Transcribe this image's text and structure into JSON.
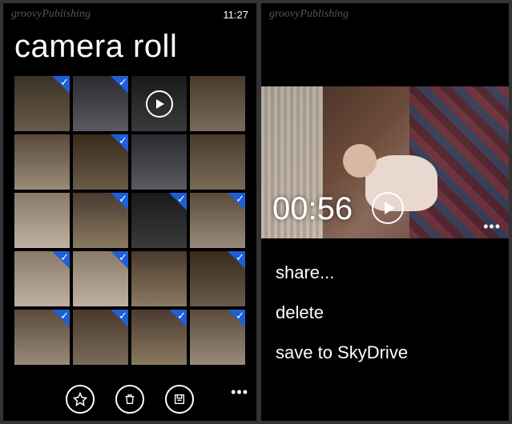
{
  "left": {
    "watermark": "groovyPublishing",
    "clock": "11:27",
    "title": "camera roll",
    "thumbs": [
      {
        "selected": true,
        "video": false,
        "palette": "p1"
      },
      {
        "selected": true,
        "video": false,
        "palette": "p2"
      },
      {
        "selected": false,
        "video": true,
        "palette": "p3"
      },
      {
        "selected": false,
        "video": false,
        "palette": "p4"
      },
      {
        "selected": false,
        "video": false,
        "palette": "p5"
      },
      {
        "selected": true,
        "video": false,
        "palette": "p6"
      },
      {
        "selected": false,
        "video": false,
        "palette": "p2"
      },
      {
        "selected": false,
        "video": false,
        "palette": "p4"
      },
      {
        "selected": false,
        "video": false,
        "palette": "p7"
      },
      {
        "selected": true,
        "video": false,
        "palette": "p8"
      },
      {
        "selected": true,
        "video": false,
        "palette": "p3"
      },
      {
        "selected": true,
        "video": false,
        "palette": "p5"
      },
      {
        "selected": true,
        "video": false,
        "palette": "p7"
      },
      {
        "selected": true,
        "video": false,
        "palette": "p7"
      },
      {
        "selected": false,
        "video": false,
        "palette": "p8"
      },
      {
        "selected": true,
        "video": false,
        "palette": "p6"
      },
      {
        "selected": true,
        "video": false,
        "palette": "p5"
      },
      {
        "selected": true,
        "video": false,
        "palette": "p4"
      },
      {
        "selected": true,
        "video": false,
        "palette": "p8"
      },
      {
        "selected": true,
        "video": false,
        "palette": "p5"
      }
    ],
    "appbar": {
      "favorite_icon": "favorite-icon",
      "delete_icon": "delete-icon",
      "save_icon": "save-icon",
      "more_icon": "more-icon"
    }
  },
  "right": {
    "watermark": "groovyPublishing",
    "video_time": "00:56",
    "menu": {
      "share": "share...",
      "delete": "delete",
      "save": "save to SkyDrive"
    }
  },
  "colors": {
    "accent": "#1e5fd8"
  }
}
